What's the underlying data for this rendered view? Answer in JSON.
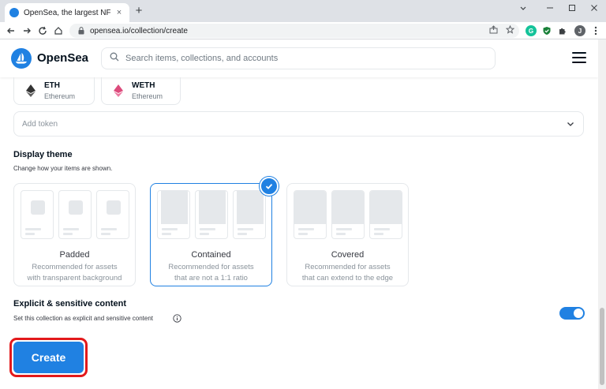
{
  "browser": {
    "tab_title": "OpenSea, the largest NFT marketplace",
    "tab_close": "×",
    "new_tab": "+",
    "url": "opensea.io/collection/create",
    "profile_initial": "J",
    "ext_grammarly": "G"
  },
  "header": {
    "brand": "OpenSea",
    "search_placeholder": "Search items, collections, and accounts"
  },
  "tokens": [
    {
      "symbol": "ETH",
      "name": "Ethereum"
    },
    {
      "symbol": "WETH",
      "name": "Ethereum"
    }
  ],
  "add_token": {
    "placeholder": "Add token"
  },
  "display_theme": {
    "title": "Display theme",
    "subtitle": "Change how your items are shown.",
    "options": [
      {
        "name": "Padded",
        "desc1": "Recommended for assets",
        "desc2": "with transparent background"
      },
      {
        "name": "Contained",
        "desc1": "Recommended for assets",
        "desc2": "that are not a 1:1 ratio"
      },
      {
        "name": "Covered",
        "desc1": "Recommended for assets",
        "desc2": "that can extend to the edge"
      }
    ],
    "selected": "Contained"
  },
  "explicit": {
    "title": "Explicit & sensitive content",
    "subtitle": "Set this collection as explicit and sensitive content",
    "enabled": true
  },
  "create_button": {
    "label": "Create"
  },
  "colors": {
    "accent": "#2081e2",
    "highlight": "#e3191b"
  }
}
